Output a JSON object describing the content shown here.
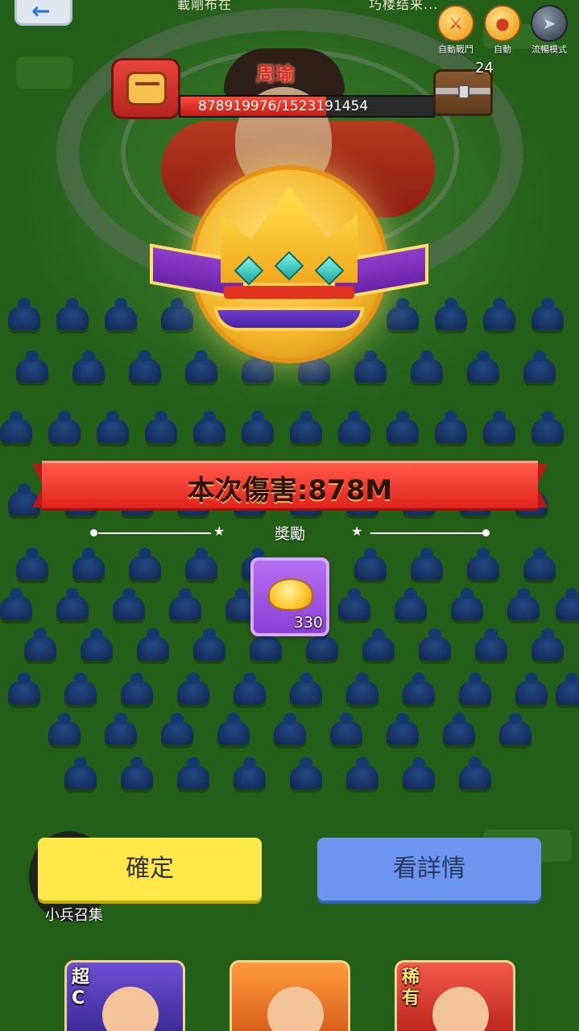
{
  "top_bar": {
    "back_icon": "back-arrow-icon",
    "caption_left": "載剛布在",
    "caption_right": "巧楼结来...",
    "buttons": [
      {
        "label": "自動戰鬥",
        "icon": "sword-icon"
      },
      {
        "label": "自動",
        "icon": "drumstick-icon"
      },
      {
        "label": "流暢模式",
        "icon": "rocket-icon"
      }
    ]
  },
  "boss": {
    "name": "周瑜",
    "hp_text": "878919976/1523191454",
    "hp_fraction": 0.577,
    "chest_count": "24"
  },
  "result": {
    "damage_text": "本次傷害:878M",
    "rewards_label": "獎勵",
    "rewards": [
      {
        "icon": "gold-ingot-icon",
        "quantity": "330"
      }
    ]
  },
  "actions": {
    "confirm_label": "確定",
    "detail_label": "看詳情"
  },
  "recruit": {
    "label": "小兵召集"
  },
  "bottom_cards": [
    {
      "tag": "超C"
    },
    {
      "tag": ""
    },
    {
      "tag": "稀有"
    }
  ],
  "colors": {
    "confirm_button": "#ffe84a",
    "detail_button": "#6c96ef",
    "banner": "#e0241d",
    "reward_frame": "#8b3fd6"
  }
}
